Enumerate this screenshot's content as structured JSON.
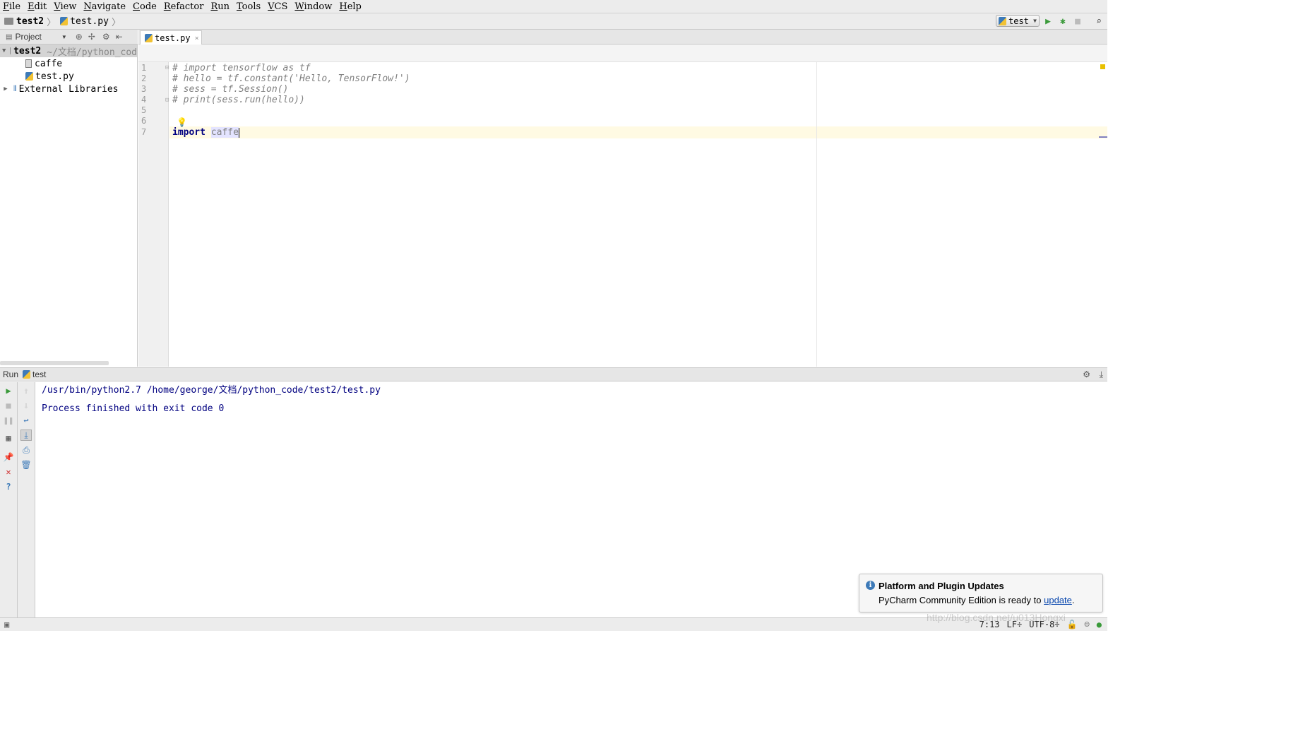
{
  "menu": [
    "File",
    "Edit",
    "View",
    "Navigate",
    "Code",
    "Refactor",
    "Run",
    "Tools",
    "VCS",
    "Window",
    "Help"
  ],
  "nav": {
    "project": "test2",
    "file": "test.py",
    "sep": "〉"
  },
  "toolbar": {
    "run_config": "test"
  },
  "project_panel": {
    "header": "Project",
    "tree": [
      {
        "label": "test2",
        "path": "~/文档/python_cod"
      },
      {
        "label": "caffe"
      },
      {
        "label": "test.py"
      },
      {
        "label": "External Libraries"
      }
    ]
  },
  "editor": {
    "tab": {
      "label": "test.py",
      "close": "×"
    },
    "lines": [
      {
        "n": "1",
        "text": "# import tensorflow as tf"
      },
      {
        "n": "2",
        "text": "# hello = tf.constant('Hello, TensorFlow!')"
      },
      {
        "n": "3",
        "text": "# sess = tf.Session()"
      },
      {
        "n": "4",
        "text": "# print(sess.run(hello))"
      },
      {
        "n": "5",
        "text": ""
      },
      {
        "n": "6",
        "text": ""
      },
      {
        "n": "7",
        "kw": "import",
        "ident": "caffe"
      }
    ]
  },
  "run_panel": {
    "label": "Run",
    "config": "test",
    "output": [
      "/usr/bin/python2.7 /home/george/文档/python_code/test2/test.py",
      "Process finished with exit code 0"
    ]
  },
  "notification": {
    "title": "Platform and Plugin Updates",
    "body": "PyCharm Community Edition is ready to",
    "link": "update",
    "tail": "."
  },
  "status_bar": {
    "position": "7:13",
    "line_sep": "LF÷",
    "encoding": "UTF-8÷"
  },
  "watermark": "http://blog.csdn.net/u013Hongxi",
  "colors": {
    "accent": "#3d7ab8",
    "run_green": "#3a9a3a",
    "console_text": "#000080"
  }
}
